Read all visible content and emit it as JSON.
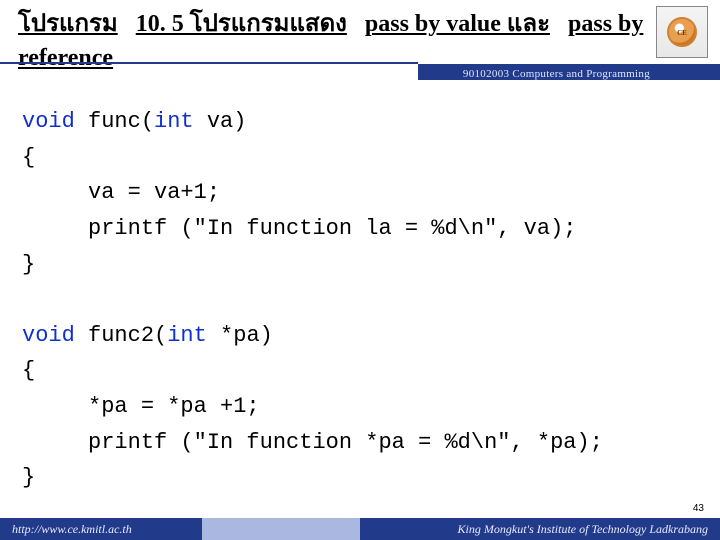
{
  "title": {
    "part1": "โปรแกรม",
    "part2": "10. 5 โปรแกรมแสดง",
    "part3": "pass by value และ",
    "part4": "pass by",
    "part5": "reference"
  },
  "course_label": "90102003 Computers and Programming",
  "logo_text": "CE",
  "code": {
    "l1a": "void",
    "l1b": " func(",
    "l1c": "int",
    "l1d": " va)",
    "l2": "{",
    "l3": "     va = va+1;",
    "l4": "     printf (\"In function la = %d\\n\", va);",
    "l5": "}",
    "blank": "",
    "l6a": "void",
    "l6b": " func2(",
    "l6c": "int",
    "l6d": " *pa)",
    "l7": "{",
    "l8": "     *pa = *pa +1;",
    "l9": "     printf (\"In function *pa = %d\\n\", *pa);",
    "l10": "}"
  },
  "page_number": "43",
  "footer": {
    "url": "http://www.ce.kmitl.ac.th",
    "org": "King Mongkut's Institute of Technology Ladkrabang"
  }
}
